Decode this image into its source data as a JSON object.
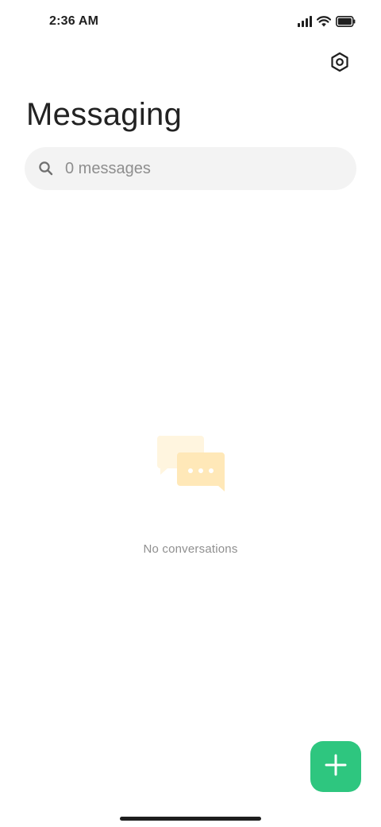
{
  "status_bar": {
    "time": "2:36 AM",
    "icons": [
      "cellular-signal-icon",
      "wifi-icon",
      "battery-icon"
    ]
  },
  "header": {
    "title": "Messaging",
    "settings_icon": "settings-hexagon-icon"
  },
  "search": {
    "placeholder": "0 messages",
    "value": "",
    "icon": "search-icon"
  },
  "empty_state": {
    "icon": "chat-bubbles-icon",
    "text": "No conversations"
  },
  "fab": {
    "icon": "plus-icon"
  },
  "colors": {
    "accent": "#2ec67f",
    "title": "#222222",
    "search_bg": "#f3f3f3",
    "muted_text": "#8f8f8f",
    "bubble_back": "#fff5df",
    "bubble_front": "#ffe8b8"
  }
}
